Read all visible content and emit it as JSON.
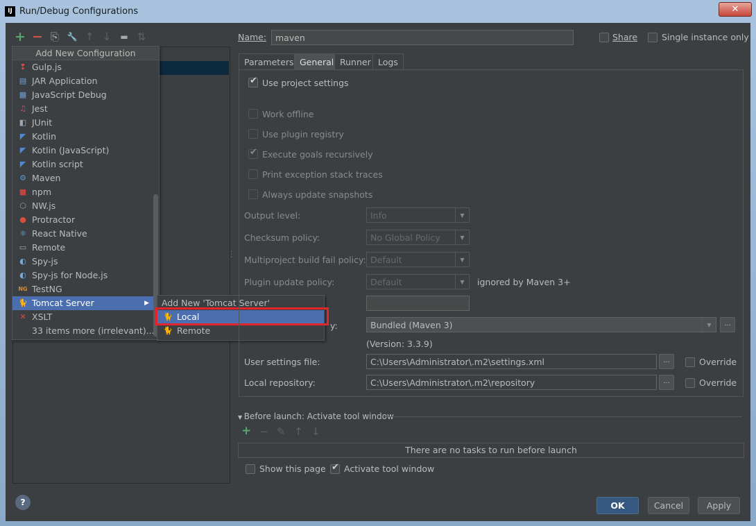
{
  "window": {
    "title": "Run/Debug Configurations",
    "app_icon_text": "IJ",
    "close_glyph": "✕"
  },
  "toolbar": {
    "add": "+",
    "remove": "−",
    "copy": "⎘",
    "edit_defaults": "🔧",
    "move_up": "↑",
    "move_down": "↓",
    "folder": "▬",
    "sort": "⇅"
  },
  "popup": {
    "title": "Add New Configuration",
    "items": [
      {
        "label": "Gulp.js",
        "icon": "gulp-icon",
        "glyph": "❢",
        "color": "#d54b4b"
      },
      {
        "label": "JAR Application",
        "icon": "jar-icon",
        "glyph": "▤",
        "color": "#6f9fd8"
      },
      {
        "label": "JavaScript Debug",
        "icon": "js-debug-icon",
        "glyph": "▦",
        "color": "#6f9fd8"
      },
      {
        "label": "Jest",
        "icon": "jest-icon",
        "glyph": "♫",
        "color": "#b9527d"
      },
      {
        "label": "JUnit",
        "icon": "junit-icon",
        "glyph": "◧",
        "color": "#9aa8b5"
      },
      {
        "label": "Kotlin",
        "icon": "kotlin-icon",
        "glyph": "◤",
        "color": "#4d8bd8"
      },
      {
        "label": "Kotlin (JavaScript)",
        "icon": "kotlin-js-icon",
        "glyph": "◤",
        "color": "#4d8bd8"
      },
      {
        "label": "Kotlin script",
        "icon": "kotlin-script-icon",
        "glyph": "◤",
        "color": "#4d8bd8"
      },
      {
        "label": "Maven",
        "icon": "maven-icon",
        "glyph": "⚙",
        "color": "#5d96c9"
      },
      {
        "label": "npm",
        "icon": "npm-icon",
        "glyph": "■",
        "color": "#c0443f"
      },
      {
        "label": "NW.js",
        "icon": "nwjs-icon",
        "glyph": "⬡",
        "color": "#8aa0b5"
      },
      {
        "label": "Protractor",
        "icon": "protractor-icon",
        "glyph": "●",
        "color": "#d84d3c"
      },
      {
        "label": "React Native",
        "icon": "react-icon",
        "glyph": "⚛",
        "color": "#61bcd8"
      },
      {
        "label": "Remote",
        "icon": "remote-icon",
        "glyph": "▭",
        "color": "#9aa8b5"
      },
      {
        "label": "Spy-js",
        "icon": "spy-js-icon",
        "glyph": "◐",
        "color": "#78a9d6"
      },
      {
        "label": "Spy-js for Node.js",
        "icon": "spy-js-node-icon",
        "glyph": "◐",
        "color": "#78a9d6"
      },
      {
        "label": "TestNG",
        "icon": "testng-icon",
        "glyph": "NG",
        "color": "#d58a3a"
      },
      {
        "label": "Tomcat Server",
        "icon": "tomcat-icon",
        "glyph": "🐈",
        "color": "#e0b33c",
        "selected": true,
        "has_submenu": true,
        "arrow": "▶"
      },
      {
        "label": "XSLT",
        "icon": "xslt-icon",
        "glyph": "✕",
        "color": "#d84d3c"
      },
      {
        "label": "33 items more (irrelevant)...",
        "icon": "",
        "glyph": "",
        "color": "#bbbbbb"
      }
    ]
  },
  "submenu": {
    "title": "Add New 'Tomcat Server' Configuration",
    "items": [
      {
        "label": "Local",
        "icon": "tomcat-local-icon",
        "glyph": "🐈",
        "selected": true
      },
      {
        "label": "Remote",
        "icon": "tomcat-remote-icon",
        "glyph": "🐈",
        "selected": false
      }
    ]
  },
  "config": {
    "name_label": "Name:",
    "name_value": "maven",
    "share_label": "Share",
    "single_instance_label": "Single instance only",
    "tabs": [
      {
        "label": "Parameters",
        "active": false
      },
      {
        "label": "General",
        "active": true
      },
      {
        "label": "Runner",
        "active": false
      },
      {
        "label": "Logs",
        "active": false
      }
    ],
    "use_project_settings": "Use project settings",
    "checkboxes": [
      {
        "label": "Work offline",
        "checked": false
      },
      {
        "label": "Use plugin registry",
        "checked": false
      },
      {
        "label": "Execute goals recursively",
        "checked": true
      },
      {
        "label": "Print exception stack traces",
        "checked": false
      },
      {
        "label": "Always update snapshots",
        "checked": false
      }
    ],
    "output_level_label": "Output level:",
    "output_level_value": "Info",
    "checksum_label": "Checksum policy:",
    "checksum_value": "No Global Policy",
    "multiproject_label": "Multiproject build fail policy:",
    "multiproject_value": "Default",
    "plugin_update_label": "Plugin update policy:",
    "plugin_update_value": "Default",
    "ignored_note": "ignored by Maven 3+",
    "maven_home_partial_label": "y:",
    "maven_home_value": "Bundled (Maven 3)",
    "maven_version": "(Version: 3.3.9)",
    "user_settings_label": "User settings file:",
    "user_settings_value": "C:\\Users\\Administrator\\.m2\\settings.xml",
    "local_repo_label": "Local repository:",
    "local_repo_value": "C:\\Users\\Administrator\\.m2\\repository",
    "override_label": "Override",
    "browse_label": "...",
    "combo_arrow": "▼"
  },
  "before_launch": {
    "title": "Before launch: Activate tool window",
    "empty_text": "There are no tasks to run before launch",
    "show_page_label": "Show this page",
    "activate_label": "Activate tool window",
    "icons": {
      "add": "+",
      "remove": "−",
      "edit": "✎",
      "up": "↑",
      "down": "↓"
    }
  },
  "buttons": {
    "ok": "OK",
    "cancel": "Cancel",
    "apply": "Apply",
    "help": "?"
  },
  "colors": {
    "accent": "#4b6eaf",
    "highlight_box": "#e3242b",
    "panel": "#3c3f41"
  }
}
